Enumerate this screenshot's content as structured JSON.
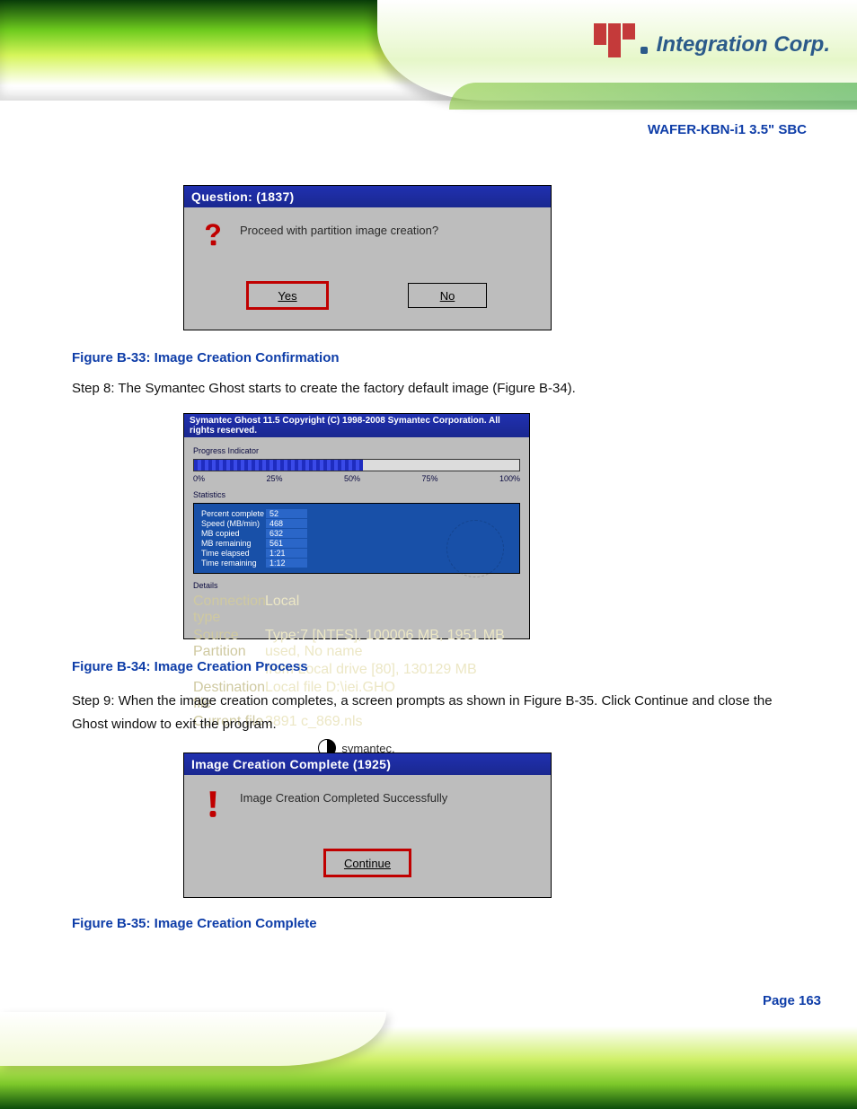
{
  "brand": {
    "logo_text": "Integration Corp."
  },
  "doc_title": "WAFER-KBN-i1 3.5\" SBC",
  "step8": "Step 8:  The Symantec Ghost starts to create the factory default image (Figure B-34).",
  "step9": "Step 9:  When the image creation completes, a screen prompts as shown in Figure B-35. Click Continue and close the Ghost window to exit the program.",
  "fig33": "Figure B-33: Image Creation Confirmation",
  "fig34": "Figure B-34: Image Creation Process",
  "fig35": "Figure B-35: Image Creation Complete",
  "page_num": "Page 163",
  "dlg1": {
    "title": "Question: (1837)",
    "msg": "Proceed with partition image creation?",
    "yes": "Yes",
    "no": "No"
  },
  "ghost": {
    "title": "Symantec Ghost 11.5   Copyright (C) 1998-2008 Symantec Corporation. All rights reserved.",
    "progress_label": "Progress Indicator",
    "ticks": [
      "0%",
      "25%",
      "50%",
      "75%",
      "100%"
    ],
    "stats_label": "Statistics",
    "stats": [
      {
        "k": "Percent complete",
        "v": "52"
      },
      {
        "k": "Speed (MB/min)",
        "v": "468"
      },
      {
        "k": "MB copied",
        "v": "632"
      },
      {
        "k": "MB remaining",
        "v": "561"
      },
      {
        "k": "Time elapsed",
        "v": "1:21"
      },
      {
        "k": "Time remaining",
        "v": "1:12"
      }
    ],
    "details_label": "Details",
    "details": [
      {
        "k": "Connection type",
        "v": "Local"
      },
      {
        "k": "Source Partition",
        "v": "Type:7 [NTFS], 100006 MB, 1951 MB used, No name"
      },
      {
        "k": "",
        "v": "from Local drive [80], 130129 MB"
      },
      {
        "k": "Destination file",
        "v": "Local file D:\\iei.GHO"
      },
      {
        "k": "Current file",
        "v": "3891 c_869.nls"
      }
    ],
    "brand": "symantec."
  },
  "dlg3": {
    "title": "Image Creation Complete (1925)",
    "msg": "Image Creation Completed Successfully",
    "continue": "Continue"
  }
}
